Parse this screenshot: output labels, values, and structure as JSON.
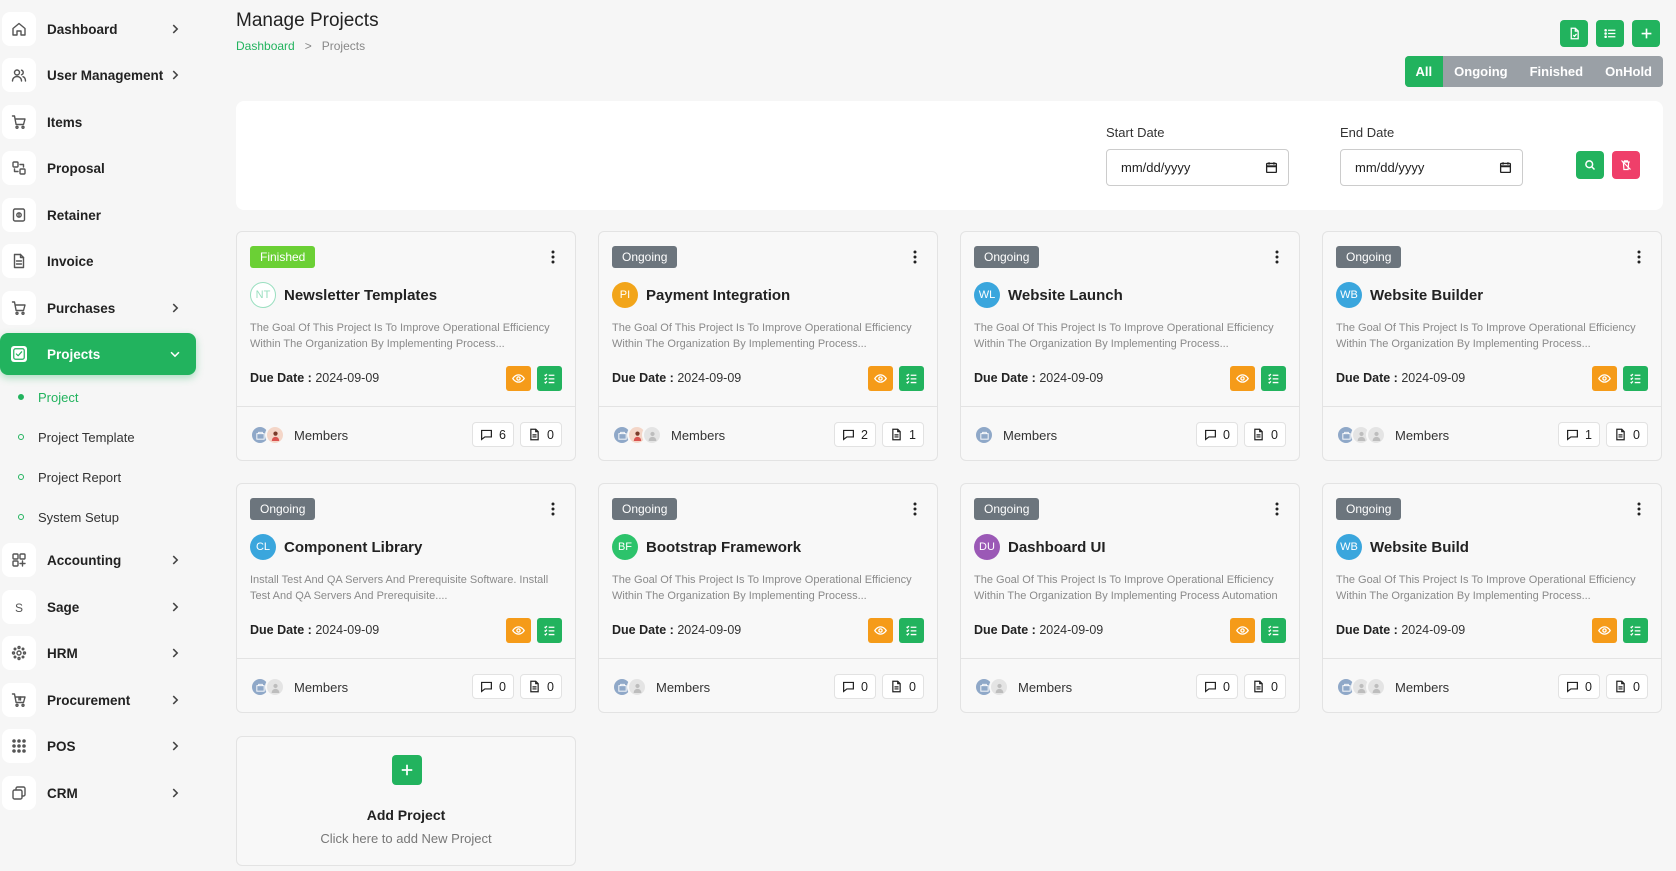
{
  "sidebar": {
    "items": [
      {
        "label": "Dashboard",
        "icon": "home-icon",
        "chevron": true
      },
      {
        "label": "User Management",
        "icon": "users-icon",
        "chevron": true
      },
      {
        "label": "Items",
        "icon": "cart-icon",
        "chevron": false
      },
      {
        "label": "Proposal",
        "icon": "proposal-icon",
        "chevron": false
      },
      {
        "label": "Retainer",
        "icon": "retainer-icon",
        "chevron": false
      },
      {
        "label": "Invoice",
        "icon": "invoice-icon",
        "chevron": false
      },
      {
        "label": "Purchases",
        "icon": "cart-icon",
        "chevron": true
      },
      {
        "label": "Projects",
        "icon": "check-square-icon",
        "chevron": true,
        "active": true
      },
      {
        "label": "Accounting",
        "icon": "grid-icon",
        "chevron": true
      },
      {
        "label": "Sage",
        "icon": "sage-icon",
        "chevron": true
      },
      {
        "label": "HRM",
        "icon": "hrm-icon",
        "chevron": true
      },
      {
        "label": "Procurement",
        "icon": "procurement-icon",
        "chevron": true
      },
      {
        "label": "POS",
        "icon": "dots-grid-icon",
        "chevron": true
      },
      {
        "label": "CRM",
        "icon": "crm-icon",
        "chevron": true
      }
    ],
    "sub_items": [
      {
        "label": "Project",
        "active": true
      },
      {
        "label": "Project Template"
      },
      {
        "label": "Project Report"
      },
      {
        "label": "System Setup"
      }
    ]
  },
  "header": {
    "title": "Manage Projects",
    "breadcrumb_home": "Dashboard",
    "breadcrumb_sep": ">",
    "breadcrumb_current": "Projects"
  },
  "filter_tabs": [
    "All",
    "Ongoing",
    "Finished",
    "OnHold"
  ],
  "filters": {
    "start_label": "Start Date",
    "end_label": "End Date",
    "start_value": "mm/dd/yyyy",
    "end_value": "mm/dd/yyyy"
  },
  "labels": {
    "due": "Due Date :",
    "members": "Members",
    "add_title": "Add Project",
    "add_sub": "Click here to add New Project"
  },
  "colors": {
    "primary": "#22b35e",
    "warning": "#f59b19",
    "danger": "#ef3f6a",
    "finished_badge": "#6bd035",
    "ongoing_badge": "#6c757d"
  },
  "projects": [
    {
      "status": "Finished",
      "initials": "NT",
      "avatar_color": "#ffffff",
      "title": "Newsletter Templates",
      "desc": "The Goal Of This Project Is To Improve Operational Efficiency Within The Organization By Implementing Process...",
      "due": "2024-09-09",
      "comments": "6",
      "files": "0",
      "members": [
        "photo",
        "woman"
      ]
    },
    {
      "status": "Ongoing",
      "initials": "PI",
      "avatar_color": "#f2a51a",
      "title": "Payment Integration",
      "desc": "The Goal Of This Project Is To Improve Operational Efficiency Within The Organization By Implementing Process...",
      "due": "2024-09-09",
      "comments": "2",
      "files": "1",
      "members": [
        "photo",
        "woman",
        "user"
      ]
    },
    {
      "status": "Ongoing",
      "initials": "WL",
      "avatar_color": "#3aa6dd",
      "title": "Website Launch",
      "desc": "The Goal Of This Project Is To Improve Operational Efficiency Within The Organization By Implementing Process...",
      "due": "2024-09-09",
      "comments": "0",
      "files": "0",
      "members": [
        "photo"
      ]
    },
    {
      "status": "Ongoing",
      "initials": "WB",
      "avatar_color": "#3aa6dd",
      "title": "Website Builder",
      "desc": "The Goal Of This Project Is To Improve Operational Efficiency Within The Organization By Implementing Process...",
      "due": "2024-09-09",
      "comments": "1",
      "files": "0",
      "members": [
        "photo",
        "user",
        "user"
      ]
    },
    {
      "status": "Ongoing",
      "initials": "CL",
      "avatar_color": "#3aa6dd",
      "title": "Component Library",
      "desc": "Install Test And QA Servers And Prerequisite Software. Install Test And QA Servers And Prerequisite....",
      "due": "2024-09-09",
      "comments": "0",
      "files": "0",
      "members": [
        "photo",
        "user"
      ]
    },
    {
      "status": "Ongoing",
      "initials": "BF",
      "avatar_color": "#2cc36b",
      "title": "Bootstrap Framework",
      "desc": "The Goal Of This Project Is To Improve Operational Efficiency Within The Organization By Implementing Process...",
      "due": "2024-09-09",
      "comments": "0",
      "files": "0",
      "members": [
        "photo",
        "user"
      ]
    },
    {
      "status": "Ongoing",
      "initials": "DU",
      "avatar_color": "#9b59b6",
      "title": "Dashboard UI",
      "desc": "The Goal Of This Project Is To Improve Operational Efficiency Within The Organization By Implementing Process Automation",
      "due": "2024-09-09",
      "comments": "0",
      "files": "0",
      "members": [
        "photo",
        "user"
      ]
    },
    {
      "status": "Ongoing",
      "initials": "WB",
      "avatar_color": "#3aa6dd",
      "title": "Website Build",
      "desc": "The Goal Of This Project Is To Improve Operational Efficiency Within The Organization By Implementing Process...",
      "due": "2024-09-09",
      "comments": "0",
      "files": "0",
      "members": [
        "photo",
        "user",
        "user"
      ]
    }
  ]
}
